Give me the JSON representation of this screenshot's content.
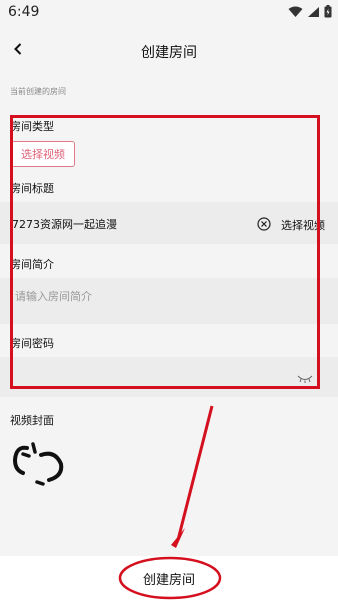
{
  "status_bar": {
    "time": "6:49",
    "icons": [
      "wifi-icon",
      "signal-icon",
      "battery-icon"
    ]
  },
  "nav": {
    "back_icon": "chevron-left-icon",
    "title": "创建房间"
  },
  "form": {
    "section_caption": "当前创建的房间",
    "room_type_label": "房间类型",
    "select_video_button": "选择视频",
    "room_title_label": "房间标题",
    "room_title_value": "7273资源网一起追漫",
    "clear_icon": "clear-circle-icon",
    "title_select_video": "选择视频",
    "room_intro_label": "房间简介",
    "room_intro_placeholder": "请输入房间简介",
    "room_password_label": "房间密码",
    "password_toggle_icon": "eye-closed-icon",
    "cover_label": "视频封面",
    "cover_icon": "broken-link-icon"
  },
  "bottom": {
    "create_button": "创建房间"
  },
  "colors": {
    "accent": "#e0627a",
    "annotation": "#d40f1e",
    "background": "#f4f4f4",
    "input_bg": "#ececec"
  }
}
